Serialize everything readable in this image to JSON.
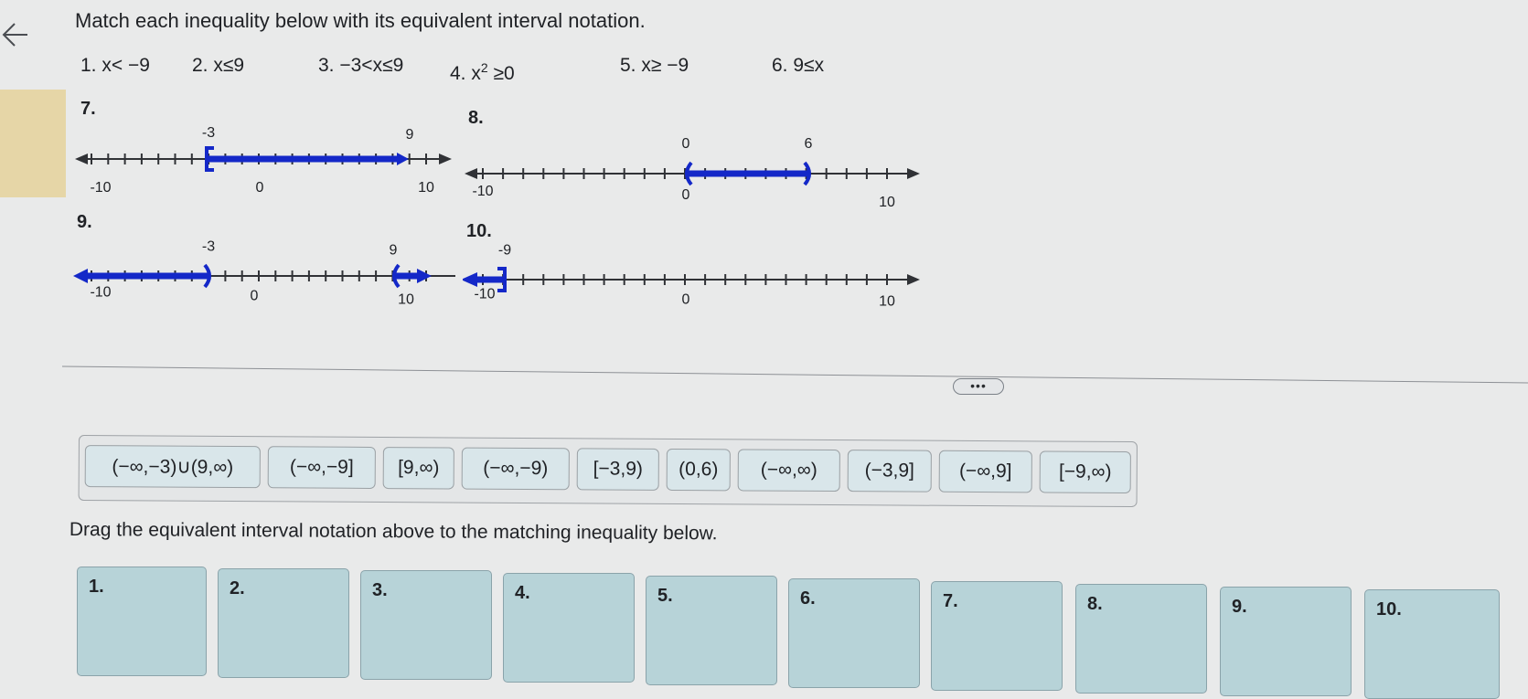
{
  "question": {
    "title": "Match each inequality below with its equivalent interval notation."
  },
  "inequalities": [
    {
      "num": "1.",
      "text": "x< −9"
    },
    {
      "num": "2.",
      "text": "x≤9"
    },
    {
      "num": "3.",
      "text": "−3<x≤9"
    },
    {
      "num": "4.",
      "base": "x",
      "exp": "2",
      "rest": "≥0"
    },
    {
      "num": "5.",
      "text": "x≥ −9"
    },
    {
      "num": "6.",
      "text": "9≤x"
    }
  ],
  "number_lines": [
    {
      "label": "7.",
      "axis_min": -10,
      "axis_max": 10,
      "labels_below": [
        "-10",
        "0",
        "10"
      ],
      "left_label": "-3",
      "right_label": "9",
      "shading": [
        {
          "from": -3,
          "to": 9,
          "left_end": "closed-bracket",
          "right_end": "arrowhead-at-point"
        }
      ]
    },
    {
      "label": "8.",
      "axis_min": -10,
      "axis_max": 10,
      "labels_below": [
        "-10",
        "0",
        "10"
      ],
      "left_label": "0",
      "right_label": "6",
      "shading": [
        {
          "from": 0,
          "to": 6,
          "left_end": "open-paren",
          "right_end": "open-paren"
        }
      ]
    },
    {
      "label": "9.",
      "axis_min": -10,
      "axis_max": 10,
      "labels_below": [
        "-10",
        "0",
        "10"
      ],
      "left_label": "-3",
      "right_label": "9",
      "shading": [
        {
          "from": "-infinity",
          "to": -3,
          "right_end": "open-paren"
        },
        {
          "from": 9,
          "to": "infinity",
          "left_end": "open-paren"
        }
      ]
    },
    {
      "label": "10.",
      "axis_min": -10,
      "axis_max": 10,
      "labels_below": [
        "-10",
        "0",
        "10"
      ],
      "left_label": "-9",
      "shading": [
        {
          "from": "-infinity",
          "to": -9,
          "right_end": "closed-bracket"
        }
      ]
    }
  ],
  "more_button_label": "•••",
  "answer_bank": [
    "(−∞,−3)∪(9,∞)",
    "(−∞,−9]",
    "[9,∞)",
    "(−∞,−9)",
    "[−3,9)",
    "(0,6)",
    "(−∞,∞)",
    "(−3,9]",
    "(−∞,9]",
    "[−9,∞)"
  ],
  "instruction": "Drag the equivalent interval notation above to the matching inequality below.",
  "drop_targets": [
    "1.",
    "2.",
    "3.",
    "4.",
    "5.",
    "6.",
    "7.",
    "8.",
    "9.",
    "10."
  ],
  "colors": {
    "shade": "#1428c8",
    "axis": "#303236",
    "tile": "#d9e6ea",
    "drop": "#b7d3d8"
  }
}
